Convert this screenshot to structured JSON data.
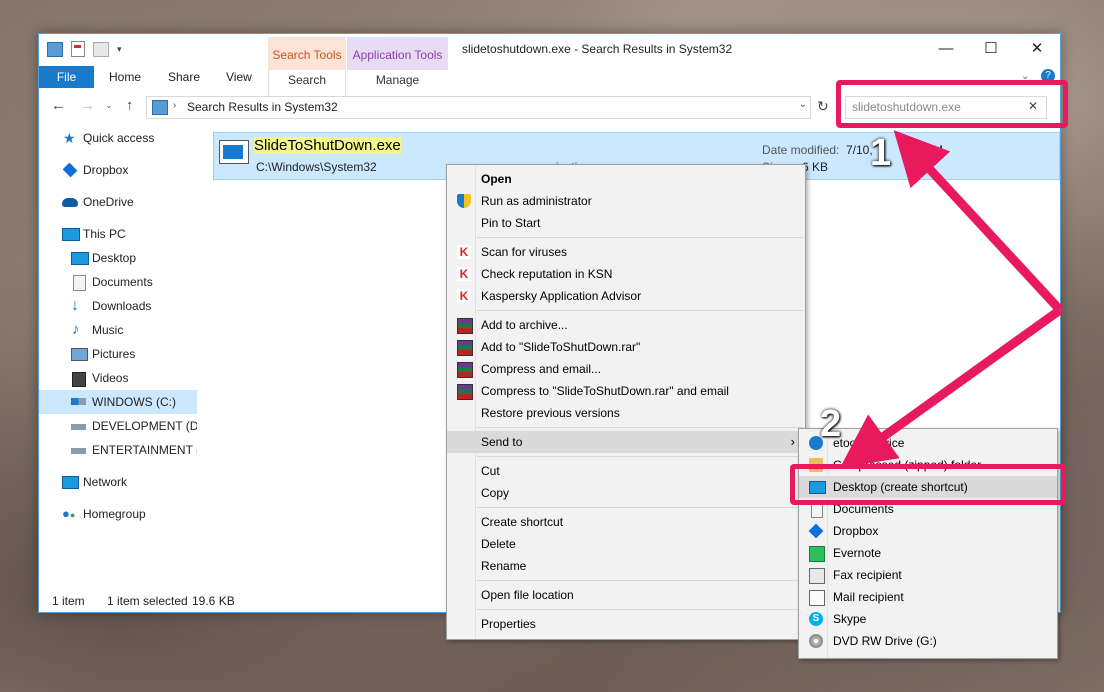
{
  "window": {
    "title": "slidetoshutdown.exe - Search Results in System32",
    "controls": {
      "minimize": "—",
      "maximize": "☐",
      "close": "✕"
    }
  },
  "ribbon": {
    "tabs": [
      "File",
      "Home",
      "Share",
      "View"
    ],
    "contextual": [
      {
        "group": "Search Tools",
        "tab": "Search"
      },
      {
        "group": "Application Tools",
        "tab": "Manage"
      }
    ]
  },
  "address": {
    "path": "Search Results in System32",
    "search_value": "slidetoshutdown.exe"
  },
  "nav": {
    "items": [
      {
        "label": "Quick access",
        "icon": "star-icon"
      },
      {
        "label": "Dropbox",
        "icon": "dropbox-icon"
      },
      {
        "label": "OneDrive",
        "icon": "cloud-icon"
      },
      {
        "label": "This PC",
        "icon": "computer-icon"
      },
      {
        "label": "Desktop",
        "icon": "desktop-icon"
      },
      {
        "label": "Documents",
        "icon": "documents-icon"
      },
      {
        "label": "Downloads",
        "icon": "downloads-icon"
      },
      {
        "label": "Music",
        "icon": "music-icon"
      },
      {
        "label": "Pictures",
        "icon": "pictures-icon"
      },
      {
        "label": "Videos",
        "icon": "videos-icon"
      },
      {
        "label": "WINDOWS (C:)",
        "icon": "drive-icon"
      },
      {
        "label": "DEVELOPMENT (D:)",
        "icon": "drive-icon"
      },
      {
        "label": "ENTERTAINMENT (E",
        "icon": "drive-icon"
      },
      {
        "label": "Network",
        "icon": "network-icon"
      },
      {
        "label": "Homegroup",
        "icon": "homegroup-icon"
      }
    ]
  },
  "result": {
    "name": "SlideToShutDown.exe",
    "path": "C:\\Windows\\System32",
    "date_label": "Date modified:",
    "date_value": "7/10,",
    "date_value_tail": "5 6",
    "date_ampm": "PM",
    "size_label": "Size:",
    "size_value": "6 KB",
    "type_fragment": "ication"
  },
  "status": {
    "count": "1 item",
    "selected": "1 item selected",
    "size": "19.6 KB"
  },
  "context_menu": {
    "items": [
      "Open",
      "Run as administrator",
      "Pin to Start",
      "Scan for viruses",
      "Check reputation in KSN",
      "Kaspersky Application Advisor",
      "Add to archive...",
      "Add to \"SlideToShutDown.rar\"",
      "Compress and email...",
      "Compress to \"SlideToShutDown.rar\" and email",
      "Restore previous versions",
      "Send to",
      "Cut",
      "Copy",
      "Create shortcut",
      "Delete",
      "Rename",
      "Open file location",
      "Properties"
    ]
  },
  "send_to_menu": {
    "items": [
      "etooth device",
      "Compressed (zipped) folder",
      "Desktop (create shortcut)",
      "Documents",
      "Dropbox",
      "Evernote",
      "Fax recipient",
      "Mail recipient",
      "Skype",
      "DVD RW Drive (G:)"
    ]
  },
  "annotations": {
    "step1": "1",
    "step2": "2",
    "highlight_color": "#e8195d"
  },
  "colors": {
    "accent": "#1979ca",
    "selection": "#cce8ff"
  }
}
